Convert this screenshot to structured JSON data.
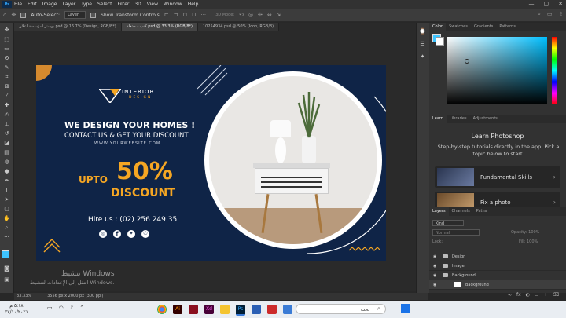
{
  "menu": [
    "File",
    "Edit",
    "Image",
    "Layer",
    "Type",
    "Select",
    "Filter",
    "3D",
    "View",
    "Window",
    "Help"
  ],
  "app_logo": "Ps",
  "options": {
    "auto_select_label": "Auto-Select:",
    "layer_select": "Layer",
    "transform_label": "Show Transform Controls",
    "mode_3d": "3D Mode:"
  },
  "tabs": [
    "بوستر لمؤسسة اعلان.psd @ 16.7% (Design, RGB/8*)",
    "كنب - مذهلة.psd @ 33.3% (RGB/8*)",
    "10254934.psd @ 50% (Icon, RGB/8)"
  ],
  "design": {
    "logo_line1": "INTERIOR",
    "logo_line2": "DESIGN",
    "headline": "WE DESIGN YOUR HOMES !",
    "subline": "CONTACT US & GET YOUR DISCOUNT",
    "website": "WWW.YOURWEBSITE.COM",
    "upto": "UPTO",
    "percent": "50%",
    "discount": "DISCOUNT",
    "hire": "Hire us : (02) 256 249 35",
    "accent_color": "#f5a623",
    "bg_color": "#0f2447"
  },
  "status": {
    "zoom": "33.33%",
    "doc_info": "3556 px x 2000 px (300 ppi)"
  },
  "color_panel_tabs": [
    "Color",
    "Swatches",
    "Gradients",
    "Patterns"
  ],
  "learn_panel_tabs": [
    "Learn",
    "Libraries",
    "Adjustments"
  ],
  "learn": {
    "title": "Learn Photoshop",
    "desc": "Step-by-step tutorials directly in the app. Pick a topic below to start.",
    "items": [
      "Fundamental Skills",
      "Fix a photo"
    ]
  },
  "layers_panel_tabs": [
    "Layers",
    "Channels",
    "Paths"
  ],
  "layers": {
    "kind": "Kind",
    "mode": "Normal",
    "opacity": "Opacity: 100%",
    "lock": "Lock:",
    "fill": "Fill: 100%",
    "items": [
      "Design",
      "Image",
      "Background",
      "Background"
    ]
  },
  "watermark": {
    "line1": "تنشيط Windows",
    "line2": "انتقل إلى الإعدادات لتنشيط Windows."
  },
  "taskbar": {
    "search": "بحث",
    "time": "٥:١٨ م",
    "date": "٢٧/١٠/٢٠٢١"
  }
}
